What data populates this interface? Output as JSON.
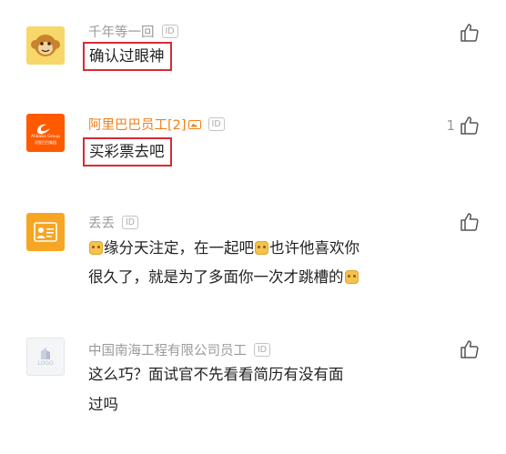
{
  "comments": [
    {
      "name": "千年等一回",
      "id_badge": "ID",
      "text": "确认过眼神",
      "likes": "",
      "avatar": "monkey-avatar"
    },
    {
      "name": "阿里巴巴员工[2]",
      "id_badge": "ID",
      "text": "买彩票去吧",
      "likes": "1",
      "avatar": "alibaba-logo",
      "avatar_text_small": "Alibaba Group",
      "avatar_text_sub": "阿里巴巴集团"
    },
    {
      "name": "丢丢",
      "id_badge": "ID",
      "text_parts": [
        "缘分天注定，在一起吧",
        "也许他喜欢你",
        "很久了，就是为了多面你一次才跳槽的"
      ],
      "likes": "",
      "avatar": "contact-card-avatar"
    },
    {
      "name": "中国南海工程有限公司员工",
      "id_badge": "ID",
      "text_line1": "这么巧？面试官不先看看简历有没有面",
      "text_line2": "过吗",
      "likes": "",
      "avatar": "logo-placeholder",
      "avatar_text": "LOGO"
    }
  ],
  "colors": {
    "highlight_box": "#d72a35",
    "brand_name": "#f0801a",
    "muted_name": "#9a9a9a"
  }
}
